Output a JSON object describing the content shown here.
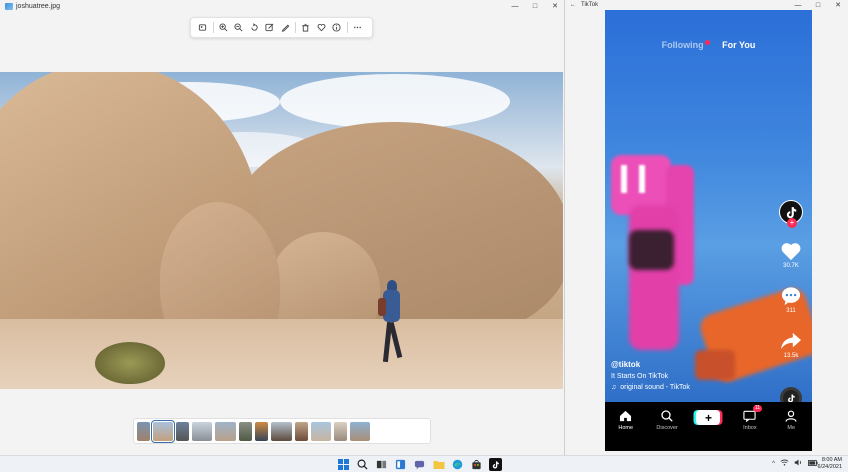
{
  "photos_window": {
    "title": "joshuatree.jpg",
    "window_controls": [
      "—",
      "□",
      "✕"
    ],
    "toolbar": {
      "buttons": [
        "crop-rotate-icon",
        "zoom-in-icon",
        "zoom-out-icon",
        "rotate-icon",
        "edit-image-icon",
        "draw-icon",
        "delete-icon",
        "favorite-icon",
        "info-icon",
        "more-icon"
      ]
    },
    "filmstrip": {
      "thumbnail_count": 12,
      "selected_index": 1
    }
  },
  "tiktok_window": {
    "title": "TikTok",
    "window_controls": [
      "—",
      "□",
      "✕"
    ],
    "feed_tabs": {
      "following": "Following",
      "for_you": "For You"
    },
    "actions": {
      "like_count": "30.7K",
      "comment_count": "311",
      "share_count": "13.5k"
    },
    "caption": {
      "username": "@tiktok",
      "description": "It Starts On TikTok",
      "sound": "original sound - TikTok"
    },
    "bottom_nav": {
      "home": "Home",
      "discover": "Discover",
      "inbox": "Inbox",
      "inbox_badge": "11",
      "me": "Me"
    }
  },
  "taskbar": {
    "time": "8:00 AM",
    "date": "6/24/2021"
  },
  "colors": {
    "tiktok_red": "#fe2c55",
    "tiktok_cyan": "#25f4ee",
    "sky_blue": "#8fb3d6",
    "sandstone": "#c9a582"
  }
}
